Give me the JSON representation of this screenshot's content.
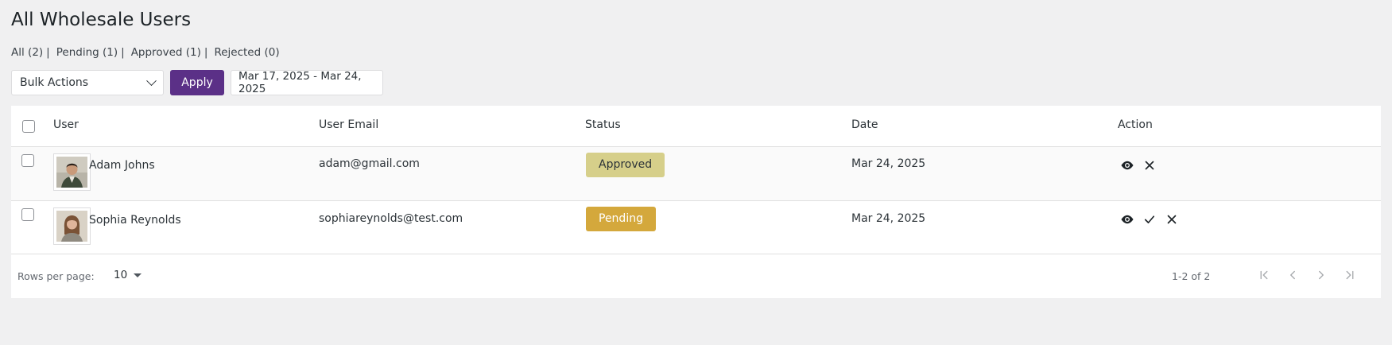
{
  "page": {
    "title": "All Wholesale Users"
  },
  "filters": [
    {
      "label": "All",
      "count": "(2)"
    },
    {
      "label": "Pending",
      "count": "(1)"
    },
    {
      "label": "Approved",
      "count": "(1)"
    },
    {
      "label": "Rejected",
      "count": "(0)"
    }
  ],
  "toolbar": {
    "bulk_actions": "Bulk Actions",
    "apply": "Apply",
    "date_range": "Mar 17, 2025 - Mar 24, 2025"
  },
  "table": {
    "columns": {
      "user": "User",
      "email": "User Email",
      "status": "Status",
      "date": "Date",
      "action": "Action"
    },
    "rows": [
      {
        "name": "Adam Johns",
        "email": "adam@gmail.com",
        "status": "Approved",
        "date": "Mar 24, 2025",
        "actions": [
          "eye-icon",
          "close-icon"
        ]
      },
      {
        "name": "Sophia Reynolds",
        "email": "sophiareynolds@test.com",
        "status": "Pending",
        "date": "Mar 24, 2025",
        "actions": [
          "eye-icon",
          "check-icon",
          "close-icon"
        ]
      }
    ]
  },
  "footer": {
    "rows_per_page_label": "Rows per page:",
    "rows_per_page_value": "10",
    "range": "1-2 of 2"
  },
  "colors": {
    "accent": "#5b3087",
    "approved": "#d6cf8a",
    "pending": "#d4a83c"
  }
}
